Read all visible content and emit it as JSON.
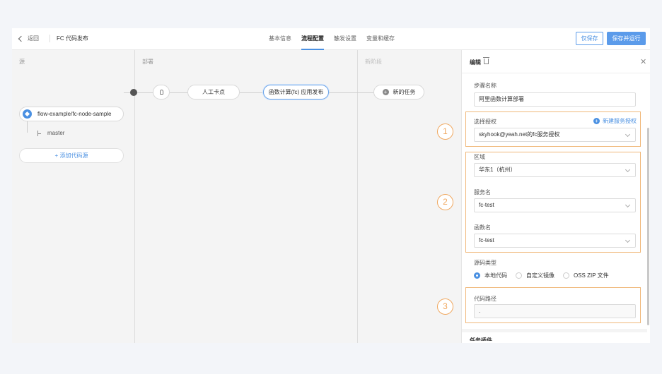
{
  "header": {
    "back_label": "返回",
    "title": "FC 代码发布",
    "tabs": [
      {
        "label": "基本信息",
        "active": false
      },
      {
        "label": "流程配置",
        "active": true
      },
      {
        "label": "触发设置",
        "active": false
      },
      {
        "label": "变量和缓存",
        "active": false
      }
    ],
    "save_only_label": "仅保存",
    "save_run_label": "保存并运行"
  },
  "pipeline": {
    "source_stage_label": "源",
    "deploy_stage_label": "部署",
    "new_stage_label": "新阶段",
    "source_repo": "flow-example/fc-node-sample",
    "branch": "master",
    "add_source_label": "+ 添加代码源",
    "manual_checkpoint_label": "人工卡点",
    "fc_deploy_label": "函数计算(fc) 应用发布",
    "new_task_label": "新的任务"
  },
  "panel": {
    "title": "编辑",
    "step_name_label": "步骤名称",
    "step_name_value": "阿里函数计算部署",
    "auth_label": "选择授权",
    "new_auth_label": "新建服务授权",
    "auth_value": "skyhook@yeah.net的fc服务授权",
    "region_label": "区域",
    "region_value": "华东1（杭州）",
    "service_label": "服务名",
    "service_value": "fc-test",
    "function_label": "函数名",
    "function_value": "fc-test",
    "source_type_label": "源码类型",
    "source_type_options": [
      {
        "label": "本地代码",
        "selected": true
      },
      {
        "label": "自定义镜像",
        "selected": false
      },
      {
        "label": "OSS ZIP 文件",
        "selected": false
      }
    ],
    "code_path_label": "代码路径",
    "code_path_value": ".",
    "next_section_label": "任务插件"
  },
  "annotations": [
    "1",
    "2",
    "3"
  ],
  "colors": {
    "accent": "#4a90e2",
    "highlight": "#f0b87a"
  }
}
